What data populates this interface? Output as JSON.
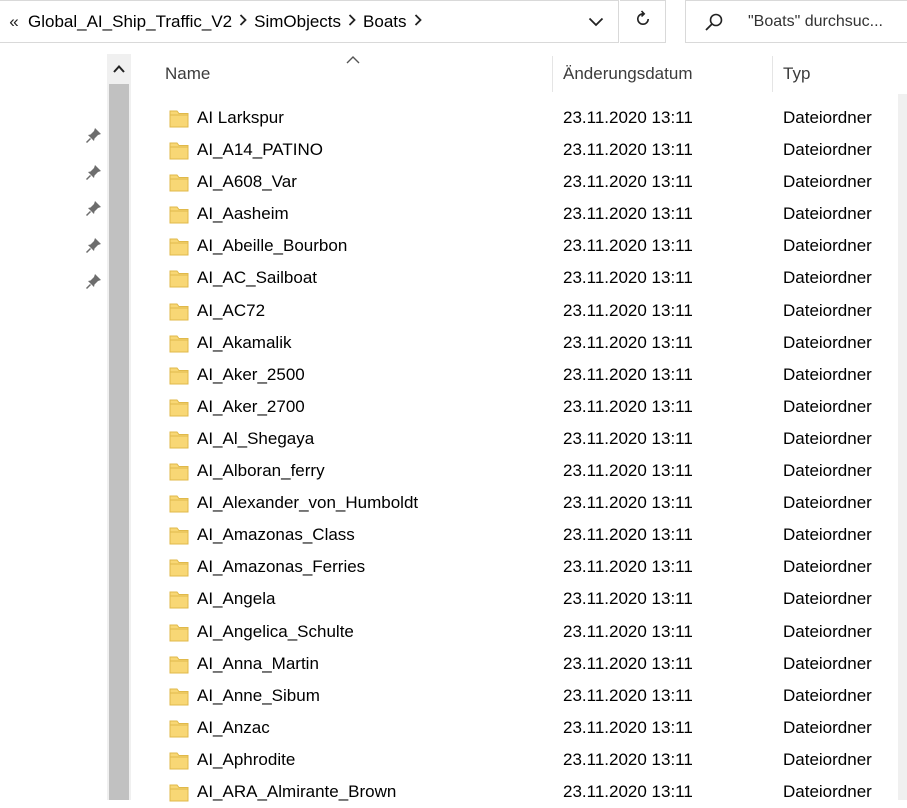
{
  "address": {
    "overflow_glyph": "«",
    "crumbs": [
      "Global_AI_Ship_Traffic_V2",
      "SimObjects",
      "Boats"
    ]
  },
  "search": {
    "placeholder": "\"Boats\" durchsuc..."
  },
  "columns": {
    "name": "Name",
    "date": "Änderungsdatum",
    "type": "Typ"
  },
  "icons": {
    "back_overflow": "double-chevron-left-icon",
    "breadcrumb_separator": "chevron-right-icon",
    "dropdown": "chevron-down-icon",
    "refresh": "refresh-icon",
    "search": "search-icon",
    "pin": "pin-icon",
    "folder": "folder-icon",
    "sort": "sort-up-icon",
    "scroll_up": "triangle-up-icon"
  },
  "colors": {
    "folder_fill": "#f8d775",
    "folder_edge": "#e0b94a",
    "scrollbar_thumb": "#c1c1c1"
  },
  "rows": [
    {
      "name": "AI Larkspur",
      "date": "23.11.2020 13:11",
      "type": "Dateiordner"
    },
    {
      "name": "AI_A14_PATINO",
      "date": "23.11.2020 13:11",
      "type": "Dateiordner"
    },
    {
      "name": "AI_A608_Var",
      "date": "23.11.2020 13:11",
      "type": "Dateiordner"
    },
    {
      "name": "AI_Aasheim",
      "date": "23.11.2020 13:11",
      "type": "Dateiordner"
    },
    {
      "name": "AI_Abeille_Bourbon",
      "date": "23.11.2020 13:11",
      "type": "Dateiordner"
    },
    {
      "name": "AI_AC_Sailboat",
      "date": "23.11.2020 13:11",
      "type": "Dateiordner"
    },
    {
      "name": "AI_AC72",
      "date": "23.11.2020 13:11",
      "type": "Dateiordner"
    },
    {
      "name": "AI_Akamalik",
      "date": "23.11.2020 13:11",
      "type": "Dateiordner"
    },
    {
      "name": "AI_Aker_2500",
      "date": "23.11.2020 13:11",
      "type": "Dateiordner"
    },
    {
      "name": "AI_Aker_2700",
      "date": "23.11.2020 13:11",
      "type": "Dateiordner"
    },
    {
      "name": "AI_Al_Shegaya",
      "date": "23.11.2020 13:11",
      "type": "Dateiordner"
    },
    {
      "name": "AI_Alboran_ferry",
      "date": "23.11.2020 13:11",
      "type": "Dateiordner"
    },
    {
      "name": "AI_Alexander_von_Humboldt",
      "date": "23.11.2020 13:11",
      "type": "Dateiordner"
    },
    {
      "name": "AI_Amazonas_Class",
      "date": "23.11.2020 13:11",
      "type": "Dateiordner"
    },
    {
      "name": "AI_Amazonas_Ferries",
      "date": "23.11.2020 13:11",
      "type": "Dateiordner"
    },
    {
      "name": "AI_Angela",
      "date": "23.11.2020 13:11",
      "type": "Dateiordner"
    },
    {
      "name": "AI_Angelica_Schulte",
      "date": "23.11.2020 13:11",
      "type": "Dateiordner"
    },
    {
      "name": "AI_Anna_Martin",
      "date": "23.11.2020 13:11",
      "type": "Dateiordner"
    },
    {
      "name": "AI_Anne_Sibum",
      "date": "23.11.2020 13:11",
      "type": "Dateiordner"
    },
    {
      "name": "AI_Anzac",
      "date": "23.11.2020 13:11",
      "type": "Dateiordner"
    },
    {
      "name": "AI_Aphrodite",
      "date": "23.11.2020 13:11",
      "type": "Dateiordner"
    },
    {
      "name": "AI_ARA_Almirante_Brown",
      "date": "23.11.2020 13:11",
      "type": "Dateiordner"
    }
  ]
}
